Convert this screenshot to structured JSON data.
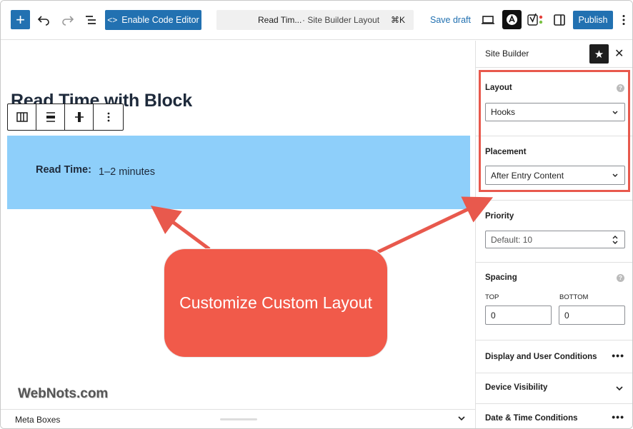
{
  "toolbar": {
    "plus_icon": "+",
    "code_editor_label": "Enable Code Editor",
    "command_title": "Read Tim...",
    "command_sub": "· Site Builder Layout",
    "command_shortcut": "⌘K",
    "save_draft_label": "Save draft",
    "publish_label": "Publish"
  },
  "canvas": {
    "post_title": "Read Time with Block",
    "read_time_label": "Read Time:",
    "read_time_value": "1–2 minutes"
  },
  "callout": {
    "text": "Customize Custom Layout"
  },
  "watermark": "WebNots.com",
  "meta_boxes": {
    "label": "Meta Boxes"
  },
  "sidebar": {
    "title": "Site Builder",
    "layout": {
      "label": "Layout",
      "value": "Hooks"
    },
    "placement": {
      "label": "Placement",
      "value": "After Entry Content"
    },
    "priority": {
      "label": "Priority",
      "value": "Default: 10"
    },
    "spacing": {
      "label": "Spacing",
      "top_label": "TOP",
      "top_value": "0",
      "bottom_label": "BOTTOM",
      "bottom_value": "0"
    },
    "collapsed_sections": [
      {
        "label": "Display and User Conditions"
      },
      {
        "label": "Device Visibility"
      },
      {
        "label": "Date & Time Conditions"
      }
    ]
  },
  "colors": {
    "primary": "#2271b1",
    "highlight_block": "#8ecffa",
    "callout": "#f15a4a",
    "annotation_red": "#e8594d"
  }
}
